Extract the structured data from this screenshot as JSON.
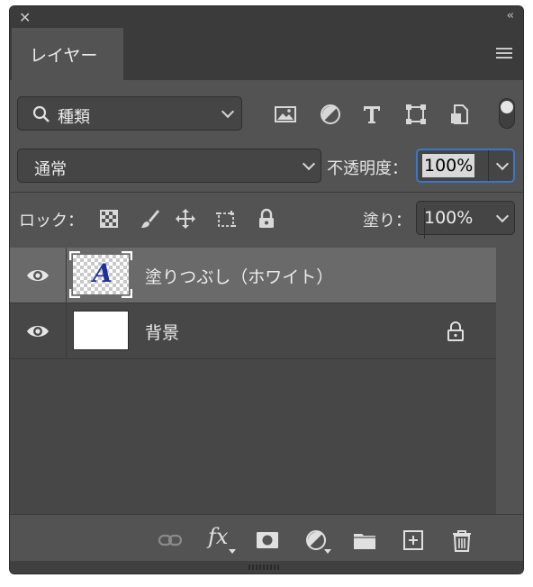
{
  "window": {
    "close_icon": "close-x-icon",
    "collapse_icon": "double-chevron-left-icon"
  },
  "tab": {
    "label": "レイヤー"
  },
  "filter": {
    "label": "種類",
    "icons": [
      "image-filter-icon",
      "adjustment-filter-icon",
      "type-filter-icon",
      "shape-filter-icon",
      "smart-object-filter-icon"
    ]
  },
  "blend": {
    "mode": "通常",
    "opacity_label": "不透明度：",
    "opacity_value": "100%"
  },
  "lock": {
    "label": "ロック：",
    "fill_label": "塗り：",
    "fill_value": "100%"
  },
  "layers": [
    {
      "name": "塗りつぶし（ホワイト）",
      "visible": true,
      "selected": true,
      "thumb_glyph": "A",
      "thumb_color": "#1e2f9e"
    },
    {
      "name": "背景",
      "visible": true,
      "selected": false,
      "locked": true
    }
  ],
  "bottom_icons": [
    "link-layers-icon",
    "fx-icon",
    "mask-icon",
    "adjustment-layer-icon",
    "folder-icon",
    "new-layer-icon",
    "trash-icon"
  ],
  "colors": {
    "panel": "#535353",
    "accent": "#3a78c6",
    "selected_row": "#6a6a6a"
  }
}
